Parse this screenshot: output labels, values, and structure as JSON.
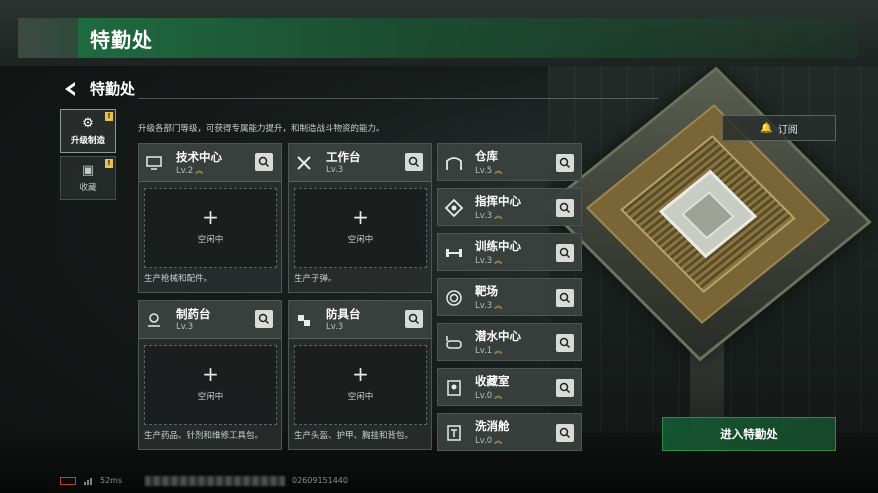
{
  "header": {
    "title": "特勤处"
  },
  "panel": {
    "title": "特勤处",
    "description": "升级各部门等级，可获得专属能力提升，和制造战斗物资的能力。",
    "subscribe_label": "订阅",
    "enter_label": "进入特勤处"
  },
  "side_tabs": [
    {
      "label": "升级制造",
      "icon": "upgrade-icon",
      "active": true,
      "alert": "!"
    },
    {
      "label": "收藏",
      "icon": "collection-icon",
      "active": false,
      "alert": "!"
    }
  ],
  "workstations": [
    {
      "name": "技术中心",
      "level": "Lv.2",
      "icon": "monitor-icon",
      "slot_status": "空闲中",
      "plus": "+",
      "desc": "生产枪械和配件。"
    },
    {
      "name": "工作台",
      "level": "Lv.3",
      "icon": "tools-icon",
      "slot_status": "空闲中",
      "plus": "+",
      "desc": "生产子弹。"
    },
    {
      "name": "制药台",
      "level": "Lv.3",
      "icon": "microscope-icon",
      "slot_status": "空闲中",
      "plus": "+",
      "desc": "生产药品、针剂和维修工具包。"
    },
    {
      "name": "防具台",
      "level": "Lv.3",
      "icon": "armor-icon",
      "slot_status": "空闲中",
      "plus": "+",
      "desc": "生产头盔、护甲、胸挂和背包。"
    }
  ],
  "rooms": [
    {
      "name": "仓库",
      "level": "Lv.5",
      "icon": "warehouse-icon"
    },
    {
      "name": "指挥中心",
      "level": "Lv.3",
      "icon": "command-icon"
    },
    {
      "name": "训练中心",
      "level": "Lv.3",
      "icon": "dumbbell-icon"
    },
    {
      "name": "靶场",
      "level": "Lv.3",
      "icon": "target-icon"
    },
    {
      "name": "潜水中心",
      "level": "Lv.1",
      "icon": "diving-mask-icon"
    },
    {
      "name": "收藏室",
      "level": "Lv.0",
      "icon": "collection-room-icon"
    },
    {
      "name": "洗消舱",
      "level": "Lv.0",
      "icon": "decontamination-icon"
    }
  ],
  "status_bar": {
    "ping": "52ms",
    "uid": "02609151440"
  },
  "colors": {
    "accent_green": "#1f6a3f",
    "level_chevron": "#e0bc52",
    "alert_yellow": "#e6c44a"
  }
}
